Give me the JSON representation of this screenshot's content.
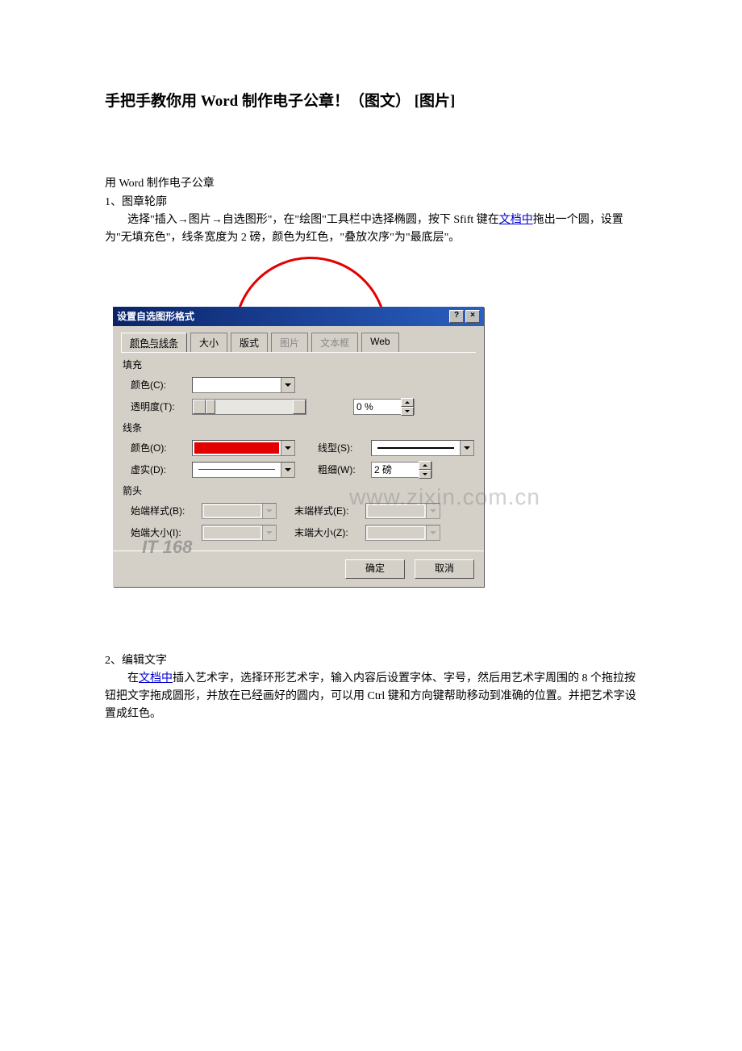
{
  "title": "手把手教你用 Word 制作电子公章！（图文） [图片]",
  "intro": {
    "line1": "用 Word 制作电子公章",
    "line2": "1、图章轮廓",
    "para_pre": "选择\"插入→图片→自选图形\"，在\"绘图\"工具栏中选择椭圆，按下 Sfift 键在",
    "link1": "文档中",
    "para_post1": "拖出一个圆，设置为\"无填充色\"，线条宽度为 2 磅，颜色为红色，\"叠放次序\"为\"最底层\"。"
  },
  "dialog": {
    "title": "设置自选图形格式",
    "help_btn": "?",
    "close_btn": "×",
    "tabs": {
      "t1": "颜色与线条",
      "t2": "大小",
      "t3": "版式",
      "t4": "图片",
      "t5": "文本框",
      "t6": "Web"
    },
    "fill_section": "填充",
    "color_label": "颜色(C):",
    "transparency_label": "透明度(T):",
    "transparency_value": "0 %",
    "line_section": "线条",
    "line_color_label": "颜色(O):",
    "line_style_label": "线型(S):",
    "dash_label": "虚实(D):",
    "weight_label": "粗细(W):",
    "weight_value": "2 磅",
    "arrow_section": "箭头",
    "begin_style_label": "始端样式(B):",
    "end_style_label": "末端样式(E):",
    "begin_size_label": "始端大小(I):",
    "end_size_label": "末端大小(Z):",
    "ok": "确定",
    "cancel": "取消"
  },
  "section2": {
    "heading": "2、编辑文字",
    "pre": "在",
    "link": "文档中",
    "post": "插入艺术字，选择环形艺术字，输入内容后设置字体、字号，然后用艺术字周围的 8 个拖拉按钮把文字拖成圆形，并放在已经画好的圆内，可以用 Ctrl 键和方向键帮助移动到准确的位置。并把艺术字设置成红色。"
  },
  "watermark": "www.zixin.com.cn",
  "wm_logo": "IT 168"
}
